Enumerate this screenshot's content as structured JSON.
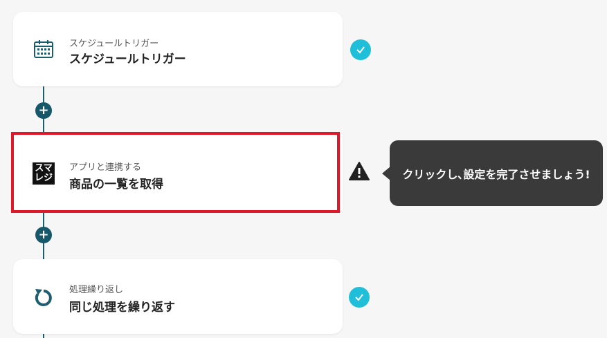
{
  "steps": [
    {
      "subtitle": "スケジュールトリガー",
      "title": "スケジュールトリガー",
      "icon": "calendar-schedule-icon",
      "status": "complete"
    },
    {
      "subtitle": "アプリと連携する",
      "title": "商品の一覧を取得",
      "icon": "smaregi-logo",
      "logo_text_top": "スマ",
      "logo_text_bottom": "レジ",
      "status": "warning"
    },
    {
      "subtitle": "処理繰り返し",
      "title": "同じ処理を繰り返す",
      "icon": "repeat-loop-icon",
      "status": "complete"
    }
  ],
  "tooltip": {
    "text": "クリックし､設定を完了させましょう!"
  },
  "colors": {
    "accent": "#17576a",
    "check": "#20bfd9",
    "highlight": "#e0192a",
    "tooltip_bg": "#3a3a3a"
  }
}
